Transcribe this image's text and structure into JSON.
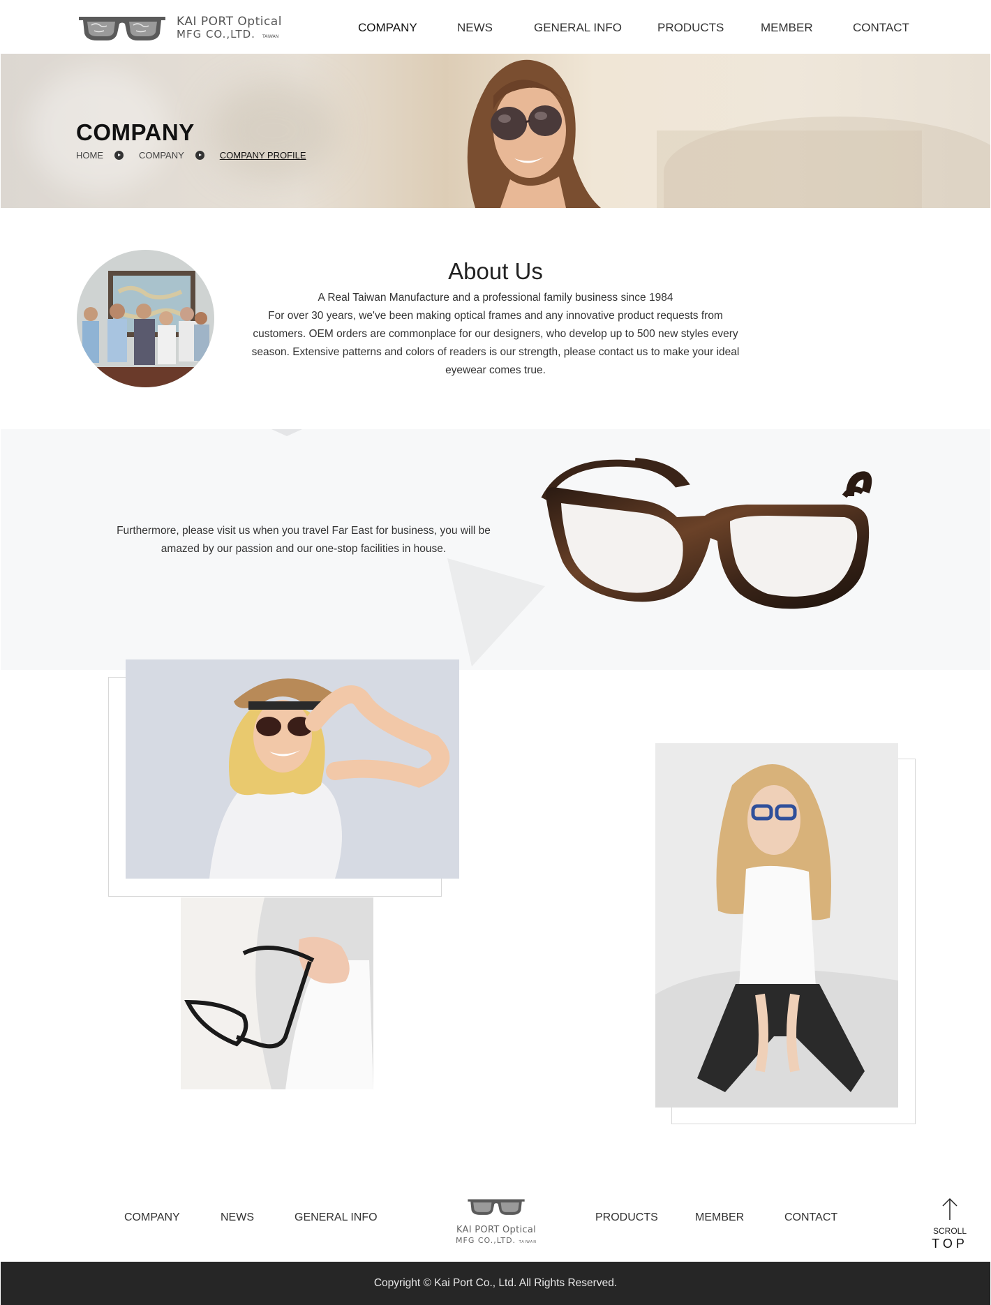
{
  "header": {
    "logo": {
      "line1": "KAI PORT Optical",
      "line2": "MFG CO.,LTD.",
      "tag": "TAIWAN"
    },
    "nav": [
      {
        "label": "COMPANY",
        "active": true
      },
      {
        "label": "NEWS"
      },
      {
        "label": "GENERAL INFO"
      },
      {
        "label": "PRODUCTS"
      },
      {
        "label": "MEMBER"
      },
      {
        "label": "CONTACT"
      }
    ]
  },
  "hero": {
    "title": "COMPANY",
    "breadcrumb": [
      "HOME",
      "COMPANY",
      "COMPANY PROFILE"
    ]
  },
  "about": {
    "title": "About Us",
    "tagline": "A Real Taiwan Manufacture and a professional family business since 1984",
    "body": "For over 30 years, we've been making optical frames and any innovative product requests from customers. OEM orders are commonplace for our designers, who develop up to 500 new styles every season. Extensive patterns and colors of readers is our strength, please contact us to make your ideal eyewear comes true."
  },
  "band": {
    "text": "Furthermore, please visit us when you travel Far East for business, you will be amazed by our passion and our one-stop facilities in house."
  },
  "footer": {
    "nav_left": [
      "COMPANY",
      "NEWS",
      "GENERAL INFO"
    ],
    "nav_right": [
      "PRODUCTS",
      "MEMBER",
      "CONTACT"
    ],
    "logo": {
      "line1": "KAI PORT Optical",
      "line2": "MFG CO.,LTD.",
      "tag": "TAIWAN"
    },
    "scroll_top": {
      "line1": "SCROLL",
      "line2": "TOP"
    },
    "copyright": "Copyright © Kai Port Co., Ltd. All Rights Reserved."
  },
  "colors": {
    "footer_bg": "#262626",
    "band_bg": "#f7f8f9",
    "text": "#2b2b2b"
  }
}
